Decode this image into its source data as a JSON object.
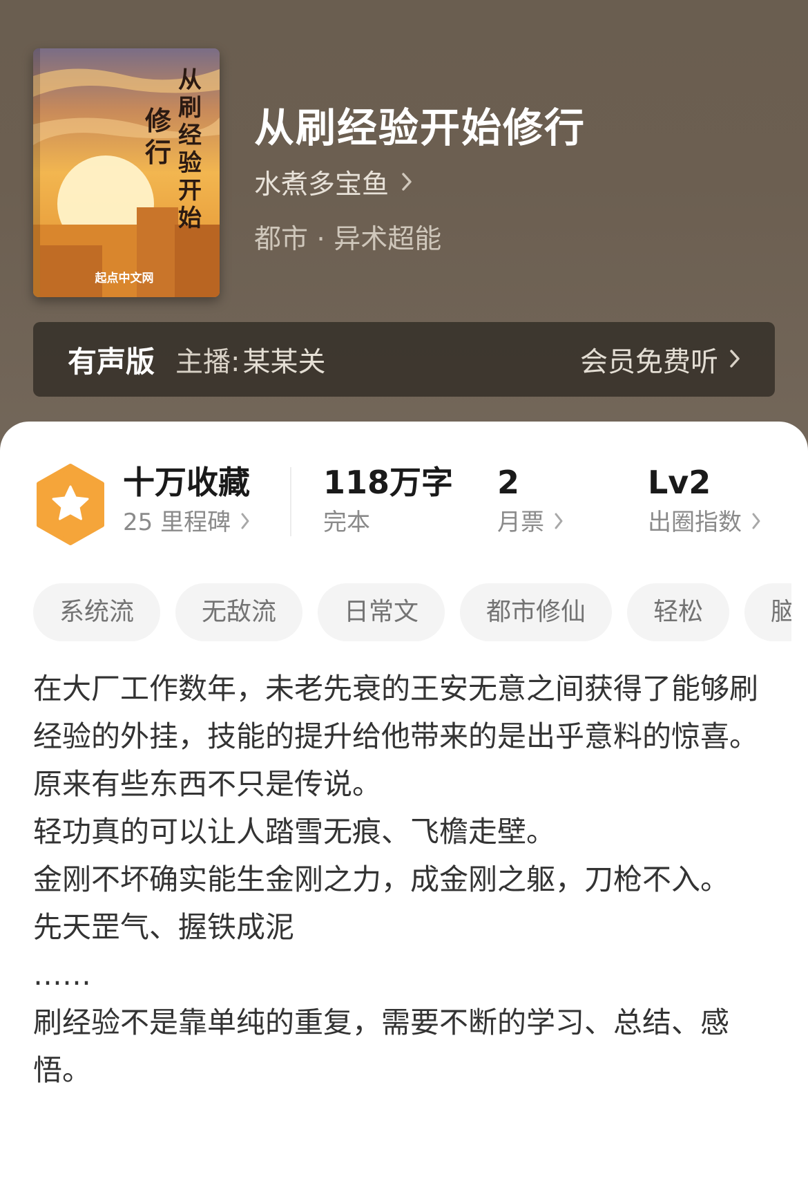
{
  "book": {
    "title": "从刷经验开始修行",
    "author": "水煮多宝鱼",
    "genre": "都市 · 异术超能"
  },
  "cover": {
    "title_col1": "从刷经验开始",
    "title_col2": "修行",
    "publisher": "起点中文网"
  },
  "audio": {
    "label": "有声版",
    "host_prefix": "主播:",
    "host_name": "某某关",
    "free_listen": "会员免费听"
  },
  "stats": {
    "collections": "十万收藏",
    "milestones": "25 里程碑",
    "word_count": "118万字",
    "status": "完本",
    "monthly_votes": "2",
    "monthly_votes_label": "月票",
    "level": "Lv2",
    "level_label": "出圈指数"
  },
  "tags": [
    "系统流",
    "无敌流",
    "日常文",
    "都市修仙",
    "轻松",
    "脑"
  ],
  "synopsis": [
    "在大厂工作数年，未老先衰的王安无意之间获得了能够刷经验的外挂，技能的提升给他带来的是出乎意料的惊喜。",
    "原来有些东西不只是传说。",
    "轻功真的可以让人踏雪无痕、飞檐走壁。",
    "金刚不坏确实能生金刚之力，成金刚之躯，刀枪不入。",
    "先天罡气、握铁成泥",
    "……",
    "刷经验不是靠单纯的重复，需要不断的学习、总结、感悟。"
  ],
  "colors": {
    "header_bg": "#6b5f52",
    "badge_orange": "#f5a53a",
    "tag_bg": "#f4f4f4"
  },
  "icons": {
    "badge": "star-hexagon-icon",
    "chevron": "chevron-right-icon"
  }
}
